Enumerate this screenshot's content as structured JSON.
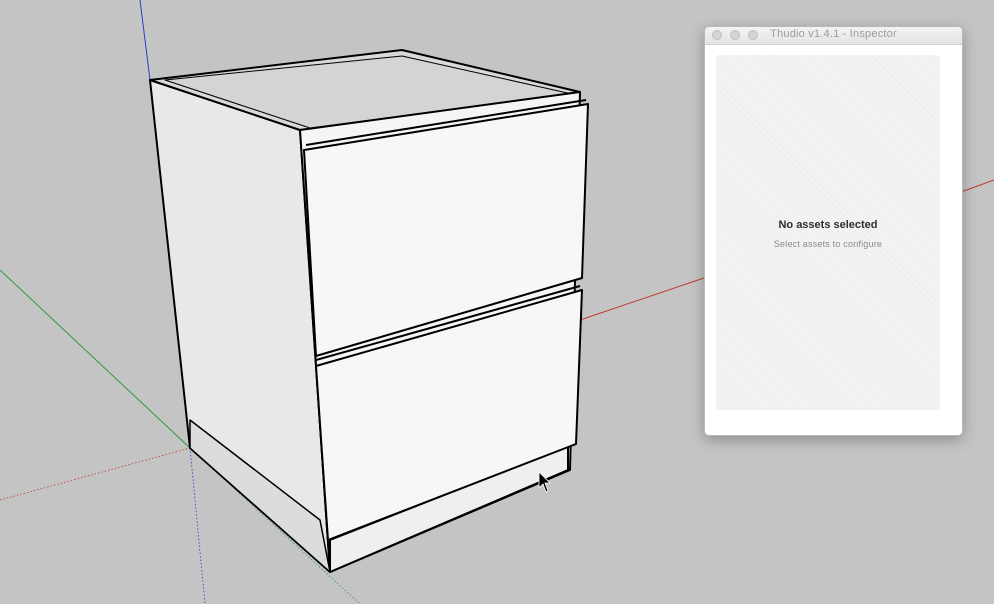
{
  "window": {
    "title": "Thudio v1.4.1 - Inspector"
  },
  "inspector": {
    "empty_title": "No assets selected",
    "empty_subtitle": "Select assets to configure"
  },
  "colors": {
    "viewport_bg": "#c4c4c4",
    "axis_red": "#c0392b",
    "axis_green": "#2e9a3c",
    "axis_blue": "#2b3ec7",
    "model_face_light": "#f7f7f7",
    "model_face_side": "#e6e6e6",
    "model_face_top": "#d9d9d9",
    "model_edge": "#000000"
  },
  "icons": {
    "cursor": "mouse-pointer-icon"
  }
}
